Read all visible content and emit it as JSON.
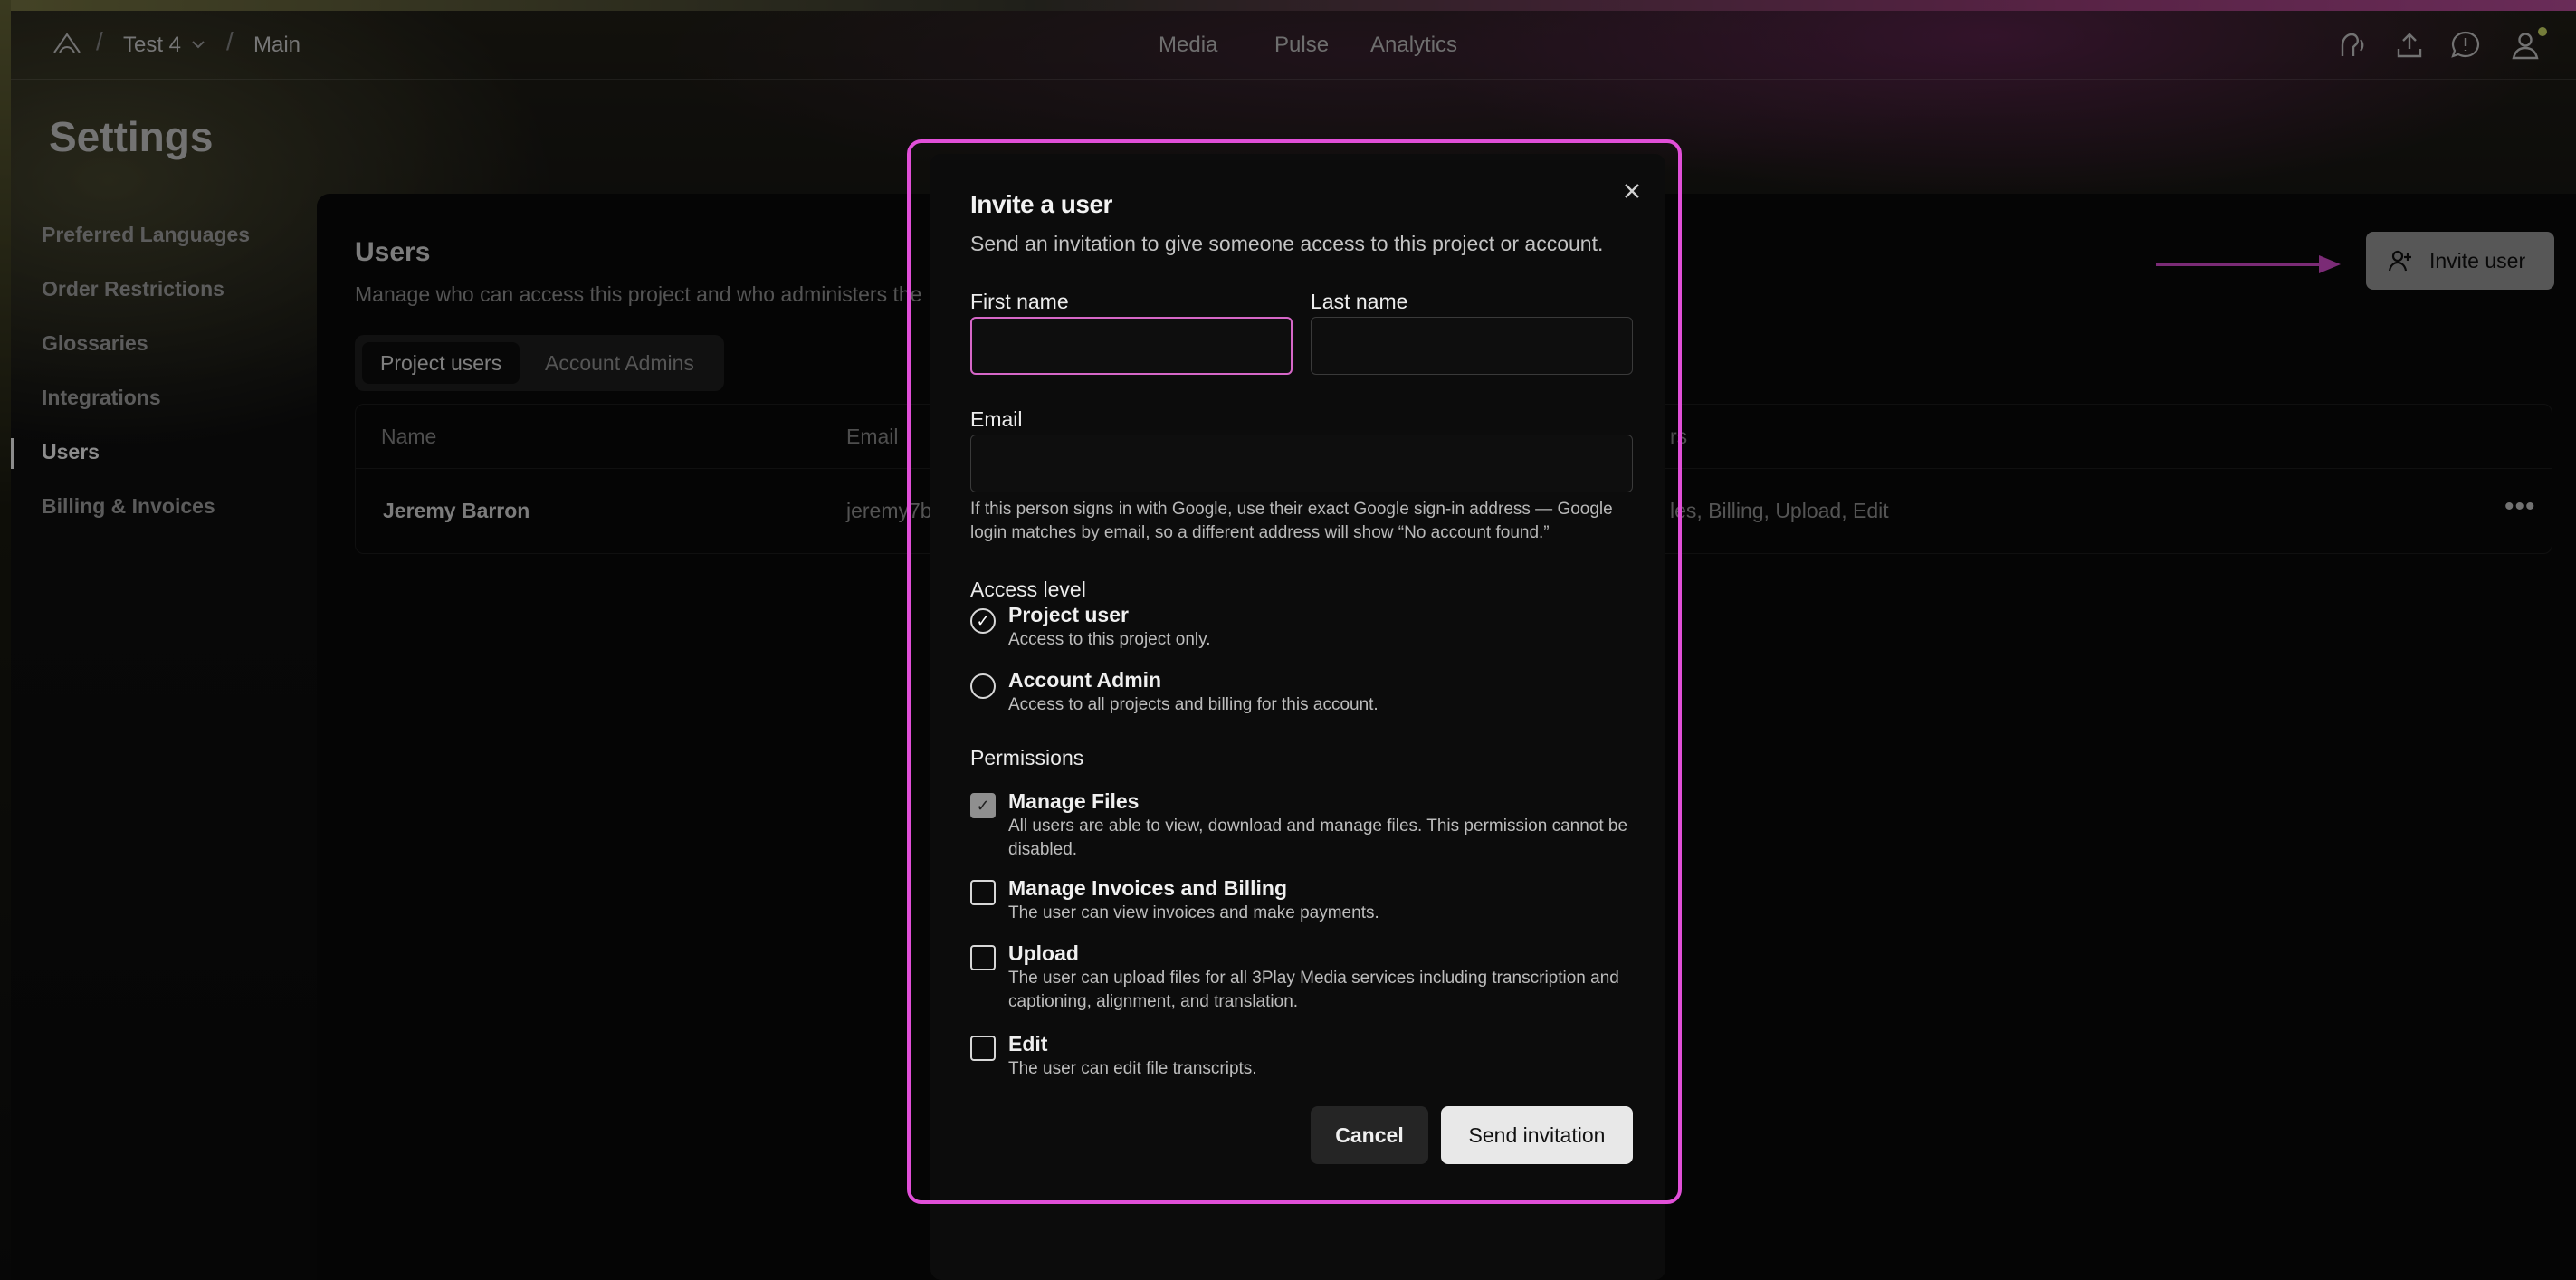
{
  "header": {
    "breadcrumb": [
      "Test 4",
      "Main"
    ],
    "nav": [
      "Media",
      "Pulse",
      "Analytics"
    ],
    "icons": [
      "voice-icon",
      "upload-icon",
      "feedback-icon",
      "account-icon"
    ]
  },
  "settings": {
    "title": "Settings",
    "sidebar": [
      "Preferred Languages",
      "Order Restrictions",
      "Glossaries",
      "Integrations",
      "Users",
      "Billing & Invoices"
    ],
    "active_item": "Users"
  },
  "users": {
    "title": "Users",
    "subtitle": "Manage who can access this project and who administers the",
    "tabs": [
      "Project users",
      "Account Admins"
    ],
    "invite_label": "Invite user",
    "table": {
      "headers": [
        "Name",
        "Email",
        "rs"
      ],
      "rows": [
        {
          "name": "Jeremy Barron",
          "email": "jeremy7b",
          "permissions": "les, Billing, Upload, Edit"
        }
      ]
    }
  },
  "modal": {
    "title": "Invite a user",
    "subtitle": "Send an invitation to give someone access to this project or account.",
    "first_name_label": "First name",
    "last_name_label": "Last name",
    "email_label": "Email",
    "first_name_value": "",
    "last_name_value": "",
    "email_value": "",
    "email_hint": "If this person signs in with Google, use their exact Google sign-in address — Google login matches by email, so a different address will show “No account found.”",
    "access_level_label": "Access level",
    "access_options": [
      {
        "title": "Project user",
        "desc": "Access to this project only.",
        "selected": true
      },
      {
        "title": "Account Admin",
        "desc": "Access to all projects and billing for this account.",
        "selected": false
      }
    ],
    "permissions_label": "Permissions",
    "permissions": [
      {
        "title": "Manage Files",
        "desc": "All users are able to view, download and manage files. This permission cannot be disabled.",
        "checked": true
      },
      {
        "title": "Manage Invoices and Billing",
        "desc": "The user can view invoices and make payments.",
        "checked": false
      },
      {
        "title": "Upload",
        "desc": "The user can upload files for all 3Play Media services including transcription and captioning, alignment, and translation.",
        "checked": false
      },
      {
        "title": "Edit",
        "desc": "The user can edit file transcripts.",
        "checked": false
      }
    ],
    "cancel_label": "Cancel",
    "send_label": "Send invitation"
  },
  "colors": {
    "highlight": "#e14fd8",
    "accent_arrow": "#e14fd8"
  }
}
